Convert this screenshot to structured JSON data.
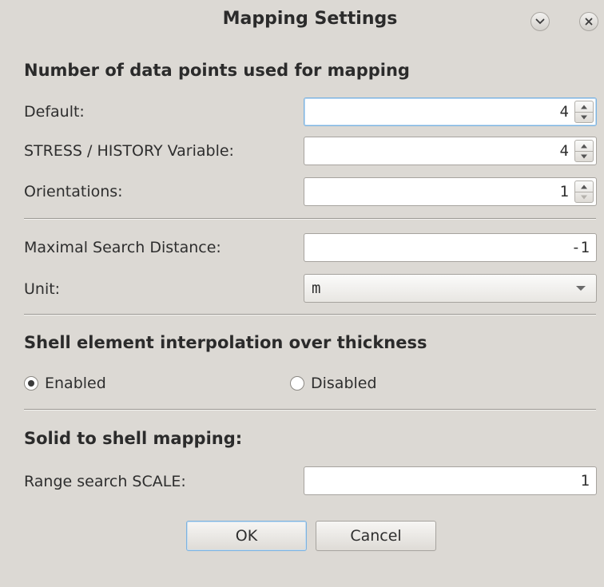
{
  "window": {
    "title": "Mapping Settings",
    "controls": [
      "shade-icon",
      "close-icon"
    ]
  },
  "data_points": {
    "heading": "Number of data points used for mapping",
    "default_label": "Default:",
    "default_value": "4",
    "stress_label": "STRESS / HISTORY Variable:",
    "stress_value": "4",
    "orientations_label": "Orientations:",
    "orientations_value": "1"
  },
  "search": {
    "max_distance_label": "Maximal Search Distance:",
    "max_distance_value": "-1",
    "unit_label": "Unit:",
    "unit_value": "m"
  },
  "shell": {
    "heading": "Shell element interpolation over thickness",
    "enabled_label": "Enabled",
    "disabled_label": "Disabled",
    "selected": "Enabled"
  },
  "solid": {
    "heading": "Solid to shell mapping:",
    "range_label": "Range search SCALE:",
    "range_value": "1"
  },
  "buttons": {
    "ok": "OK",
    "cancel": "Cancel"
  },
  "colors": {
    "background": "#dcd9d4",
    "focus": "#7db3e0"
  }
}
